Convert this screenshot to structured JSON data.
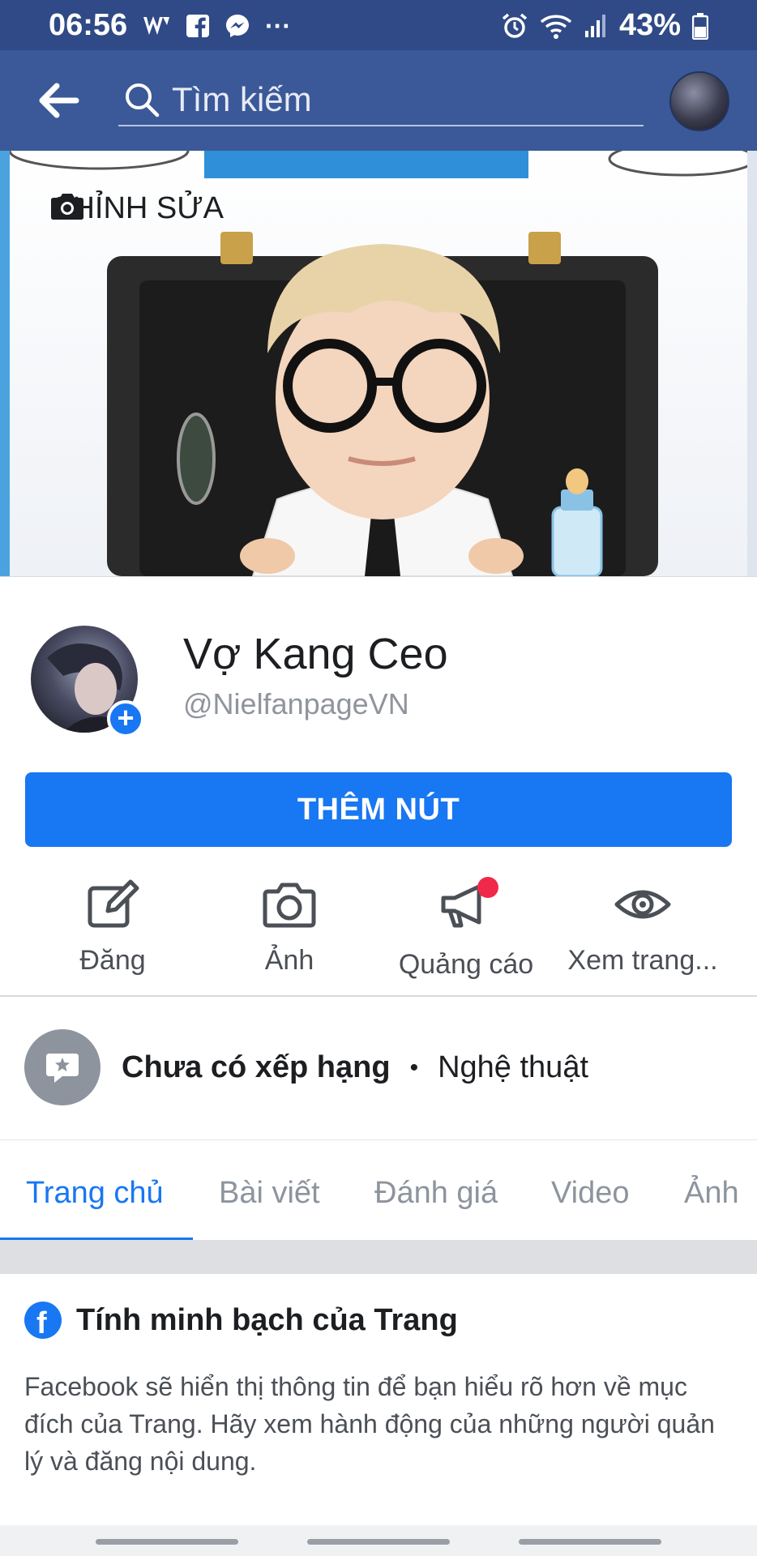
{
  "status_bar": {
    "time": "06:56",
    "battery": "43%",
    "more_dots": "···"
  },
  "app_bar": {
    "search_placeholder": "Tìm kiếm"
  },
  "cover": {
    "edit_label": "CHỈNH SỬA"
  },
  "profile": {
    "name": "Vợ Kang Ceo",
    "handle": "@NielfanpageVN",
    "add_photo_symbol": "+"
  },
  "primary_button": {
    "label": "THÊM NÚT"
  },
  "actions": [
    {
      "label": "Đăng",
      "icon": "edit-icon"
    },
    {
      "label": "Ảnh",
      "icon": "camera-icon"
    },
    {
      "label": "Quảng cáo",
      "icon": "megaphone-icon"
    },
    {
      "label": "Xem trang...",
      "icon": "eye-icon"
    }
  ],
  "rating": {
    "status": "Chưa có xếp hạng",
    "separator": "•",
    "category": "Nghệ thuật"
  },
  "tabs": [
    {
      "label": "Trang chủ",
      "active": true
    },
    {
      "label": "Bài viết",
      "active": false
    },
    {
      "label": "Đánh giá",
      "active": false
    },
    {
      "label": "Video",
      "active": false
    },
    {
      "label": "Ảnh",
      "active": false
    }
  ],
  "transparency_card": {
    "title": "Tính minh bạch của Trang",
    "body": "Facebook sẽ hiển thị thông tin để bạn hiểu rõ hơn về mục đích của Trang. Hãy xem hành động của những người quản lý và đăng nội dung."
  },
  "colors": {
    "status_bar": "#2f4a86",
    "app_bar": "#3b5998",
    "accent": "#1877f2",
    "notification_dot": "#f02849"
  }
}
